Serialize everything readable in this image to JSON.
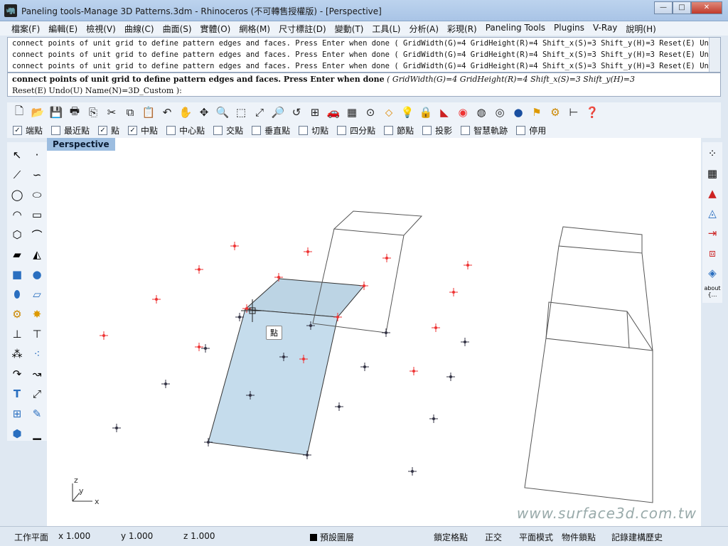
{
  "window": {
    "title": "Paneling tools-Manage 3D Patterns.3dm - Rhinoceros (不可轉售授權版) - [Perspective]",
    "min": "—",
    "max": "□",
    "close": "✕"
  },
  "menu": [
    "檔案(F)",
    "編輯(E)",
    "檢視(V)",
    "曲線(C)",
    "曲面(S)",
    "實體(O)",
    "網格(M)",
    "尺寸標註(D)",
    "變動(T)",
    "工具(L)",
    "分析(A)",
    "彩現(R)",
    "Paneling Tools",
    "Plugins",
    "V-Ray",
    "說明(H)"
  ],
  "command_history": [
    "connect points of unit grid to define pattern edges and faces.  Press Enter when done ( GridWidth(G)=4  GridHeight(R)=4  Shift_x(S)=3  Shift_y(H)=3  Reset(E)  Undo",
    "connect points of unit grid to define pattern edges and faces.  Press Enter when done ( GridWidth(G)=4  GridHeight(R)=4  Shift_x(S)=3  Shift_y(H)=3  Reset(E)  Undo",
    "connect points of unit grid to define pattern edges and faces.  Press Enter when done ( GridWidth(G)=4  GridHeight(R)=4  Shift_x(S)=3  Shift_y(H)=3  Reset(E)  Undo"
  ],
  "prompt": {
    "main": "connect points of unit grid to define pattern edges and faces.  Press Enter when done",
    "options": "( GridWidth(G)=4  GridHeight(R)=4  Shift_x(S)=3  Shift_y(H)=3",
    "line2": "Reset(E)  Undo(U)  Name(N)=3D_Custom ):"
  },
  "toolbar_icons": [
    "new-icon",
    "open-icon",
    "save-icon",
    "print-icon",
    "import-icon",
    "cut-icon",
    "copy-icon",
    "paste-icon",
    "undo-icon",
    "pan-icon",
    "rotate-view-icon",
    "zoom-window-icon",
    "zoom-dynamic-icon",
    "zoom-extents-icon",
    "zoom-selected-icon",
    "undo-view-icon",
    "four-views-icon",
    "car-icon",
    "grid-icon",
    "point-icon",
    "move-icon",
    "light-icon",
    "lock-icon",
    "layer-icon",
    "color-wheel-icon",
    "wireframe-icon",
    "mesh-sphere-icon",
    "render-sphere-icon",
    "flag-icon",
    "gear-icon",
    "dimension-icon",
    "help-icon"
  ],
  "osnaps": [
    {
      "label": "端點",
      "checked": true
    },
    {
      "label": "最近點",
      "checked": false
    },
    {
      "label": "點",
      "checked": true
    },
    {
      "label": "中點",
      "checked": true
    },
    {
      "label": "中心點",
      "checked": false
    },
    {
      "label": "交點",
      "checked": false
    },
    {
      "label": "垂直點",
      "checked": false
    },
    {
      "label": "切點",
      "checked": false
    },
    {
      "label": "四分點",
      "checked": false
    },
    {
      "label": "節點",
      "checked": false
    },
    {
      "label": "投影",
      "checked": false
    },
    {
      "label": "智慧軌跡",
      "checked": false
    },
    {
      "label": "停用",
      "checked": false
    }
  ],
  "viewport": {
    "title": "Perspective",
    "tooltip": "點",
    "watermark": "www.surface3d.com.tw",
    "axis_x": "x",
    "axis_y": "y",
    "axis_z": "z"
  },
  "right_toolbar_label": "about\n{…",
  "status": {
    "cplane": "工作平面",
    "x": "x 1.000",
    "y": "y 1.000",
    "z": "z 1.000",
    "layer": "預設圖層",
    "snap": "鎖定格點",
    "ortho": "正交",
    "planar": "平面模式",
    "osnap": "物件鎖點",
    "history": "記錄建構歷史"
  }
}
